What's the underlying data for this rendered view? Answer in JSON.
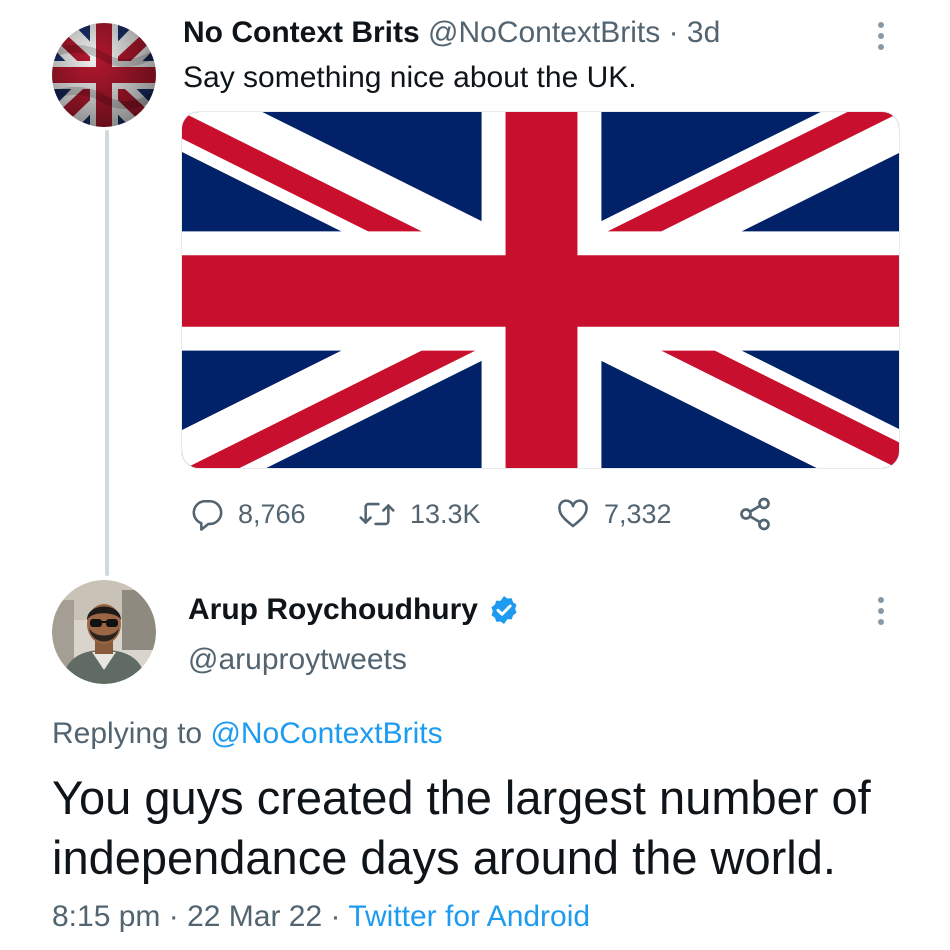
{
  "tweet1": {
    "author_name": "No Context Brits",
    "author_handle": "@NoContextBrits",
    "separator": "·",
    "time_ago": "3d",
    "text": "Say something nice about the UK.",
    "stats": {
      "replies": "8,766",
      "retweets": "13.3K",
      "likes": "7,332"
    }
  },
  "tweet2": {
    "author_name": "Arup Roychoudhury",
    "author_handle": "@aruproytweets",
    "replying_prefix": "Replying to",
    "replying_handle": "@NoContextBrits",
    "text": "You guys created the largest number of independance days around the world.",
    "time": "8:15 pm",
    "date": "22 Mar 22",
    "source": "Twitter for Android",
    "sep1": "·",
    "sep2": "·"
  },
  "colors": {
    "accent": "#1d9bf0",
    "muted": "#536471",
    "text": "#0f1419",
    "flag_blue": "#012169",
    "flag_red": "#c8102e"
  },
  "icons": {
    "reply": "reply-icon",
    "retweet": "retweet-icon",
    "like": "heart-icon",
    "share": "share-icon",
    "more": "more-options-icon",
    "verified": "verified-badge-icon"
  }
}
